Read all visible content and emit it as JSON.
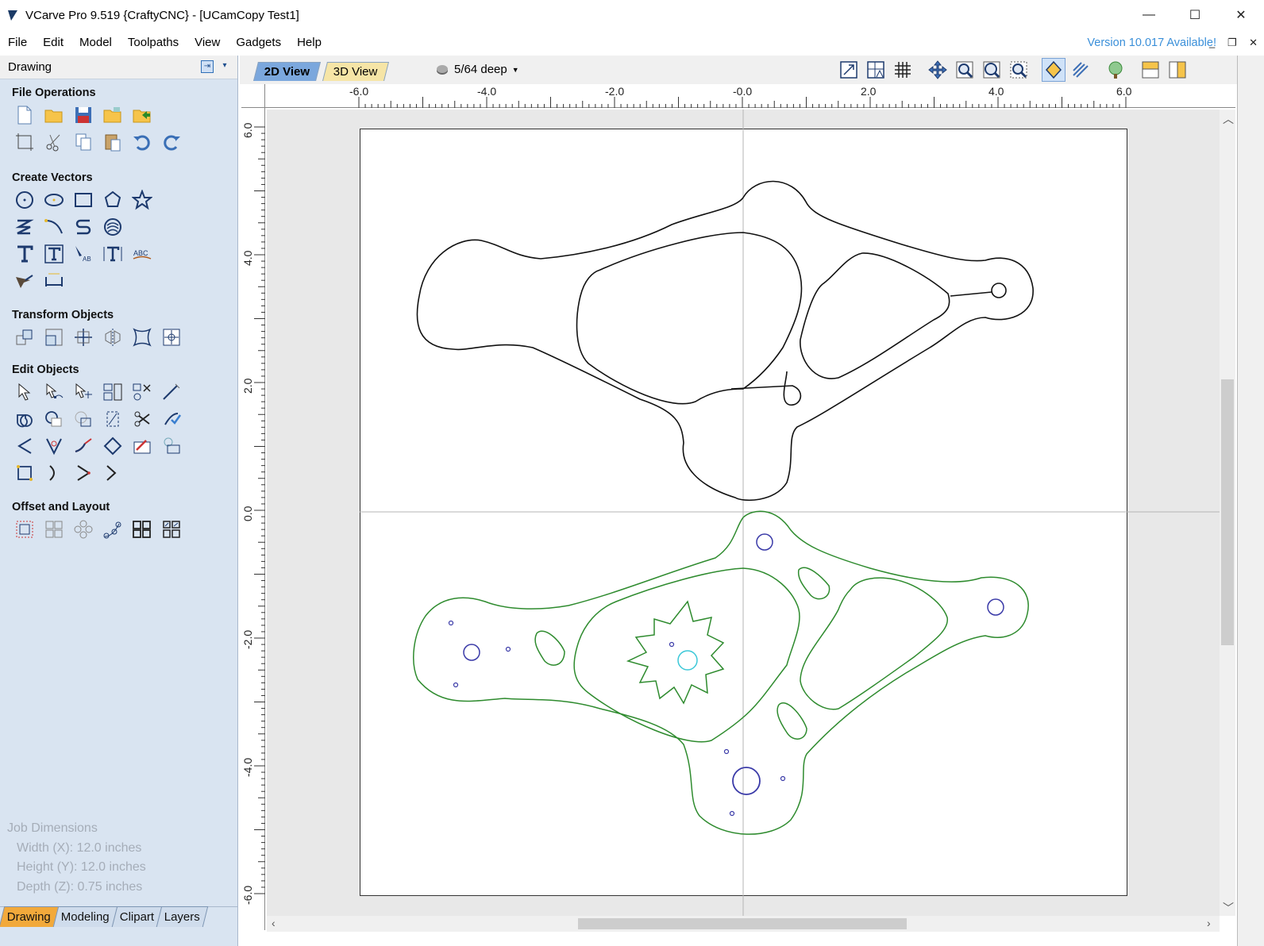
{
  "window": {
    "title": "VCarve Pro 9.519 {CraftyCNC} - [UCamCopy Test1]",
    "minimize": "—",
    "maximize": "☐",
    "close": "✕"
  },
  "menu": {
    "items": [
      "File",
      "Edit",
      "Model",
      "Toolpaths",
      "View",
      "Gadgets",
      "Help"
    ],
    "version_notice": "Version 10.017 Available!",
    "mdi_buttons": "_ ❐ ✕"
  },
  "panel": {
    "header": "Drawing",
    "sections": {
      "file_operations": "File Operations",
      "create_vectors": "Create Vectors",
      "transform_objects": "Transform Objects",
      "edit_objects": "Edit Objects",
      "offset_layout": "Offset and Layout"
    },
    "job": {
      "title": "Job Dimensions",
      "width": "Width  (X): 12.0 inches",
      "height": "Height (Y): 12.0 inches",
      "depth": "Depth  (Z): 0.75 inches"
    },
    "tabs": [
      "Drawing",
      "Modeling",
      "Clipart",
      "Layers"
    ]
  },
  "view": {
    "tab_2d": "2D View",
    "tab_3d": "3D View",
    "depth_label": "5/64 deep",
    "hruler_labels": [
      "-6.0",
      "-4.0",
      "-2.0",
      "-0.0",
      "2.0",
      "4.0",
      "6.0"
    ],
    "vruler_labels": [
      "6.0",
      "4.0",
      "2.0",
      "0.0",
      "-2.0",
      "-4.0",
      "-6.0"
    ]
  },
  "colors": {
    "accent": "#3a8fd9",
    "panel_bg": "#d9e4f1",
    "active_tab": "#f2a93b",
    "green_vectors": "#2e8b2e",
    "blue_circles": "#3a3aa8",
    "cyan_circle": "#3cc8d8"
  }
}
